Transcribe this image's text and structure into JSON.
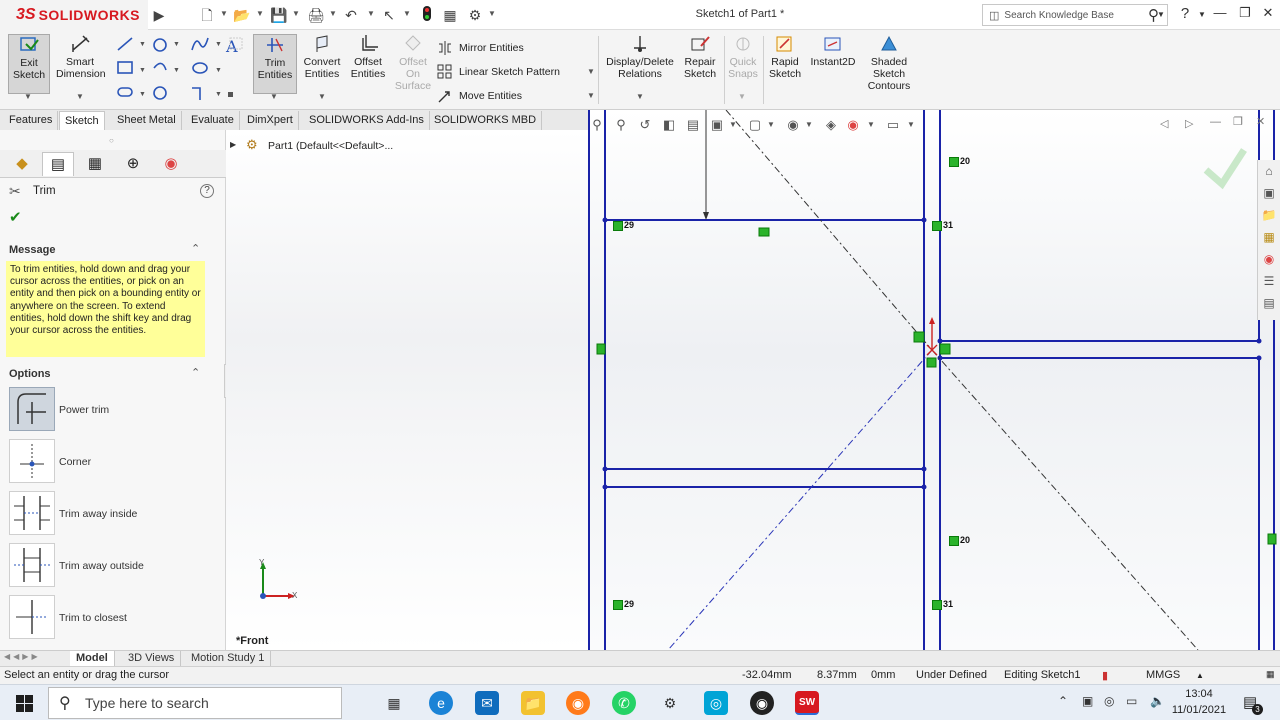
{
  "app": {
    "brand_ds": "3S",
    "brand_name": "SOLIDWORKS",
    "document_title": "Sketch1 of Part1 *",
    "search_placeholder": "Search Knowledge Base"
  },
  "command_manager": {
    "exit_sketch": "Exit Sketch",
    "smart_dimension": "Smart Dimension",
    "trim_entities": "Trim Entities",
    "convert_entities": "Convert Entities",
    "offset_entities": "Offset Entities",
    "offset_on_surface": "Offset On Surface",
    "mirror_entities": "Mirror Entities",
    "linear_sketch_pattern": "Linear Sketch Pattern",
    "move_entities": "Move Entities",
    "display_delete_relations": "Display/Delete Relations",
    "repair_sketch": "Repair Sketch",
    "quick_snaps": "Quick Snaps",
    "rapid_sketch": "Rapid Sketch",
    "instant2d": "Instant2D",
    "shaded_sketch_contours": "Shaded Sketch Contours"
  },
  "tabs": [
    "Features",
    "Sketch",
    "Sheet Metal",
    "Evaluate",
    "DimXpert",
    "SOLIDWORKS Add-Ins",
    "SOLIDWORKS MBD"
  ],
  "active_tab": "Sketch",
  "property_manager": {
    "title": "Trim",
    "message_heading": "Message",
    "message": "To trim entities, hold down and drag your cursor across the entities, or pick on an entity and then pick on a bounding entity or anywhere on the screen.  To extend entities, hold down the shift key and drag your cursor across the entities.",
    "options_heading": "Options",
    "options": [
      {
        "label": "Power trim",
        "selected": true
      },
      {
        "label": "Corner",
        "selected": false
      },
      {
        "label": "Trim away inside",
        "selected": false
      },
      {
        "label": "Trim away outside",
        "selected": false
      },
      {
        "label": "Trim to closest",
        "selected": false
      }
    ]
  },
  "tree": {
    "root": "Part1  (Default<<Default>..."
  },
  "viewport": {
    "view_name": "*Front",
    "triad_x": "X",
    "triad_y": "Y",
    "relation_labels": [
      "20",
      "29",
      "31",
      "20",
      "29",
      "31"
    ]
  },
  "bottom_tabs": [
    "Model",
    "3D Views",
    "Motion Study 1"
  ],
  "status": {
    "hint": "Select an entity or drag the cursor",
    "x": "-32.04mm",
    "y": "8.37mm",
    "z": "0mm",
    "definition": "Under Defined",
    "editing": "Editing Sketch1",
    "units": "MMGS"
  },
  "taskbar": {
    "search_placeholder": "Type here to search",
    "time": "13:04",
    "date": "11/01/2021",
    "notifications": "3"
  },
  "colors": {
    "sketch_line": "#1a23a8",
    "relation_green": "#2bb32b",
    "accent_red": "#d71920",
    "message_bg": "#ffff99"
  }
}
